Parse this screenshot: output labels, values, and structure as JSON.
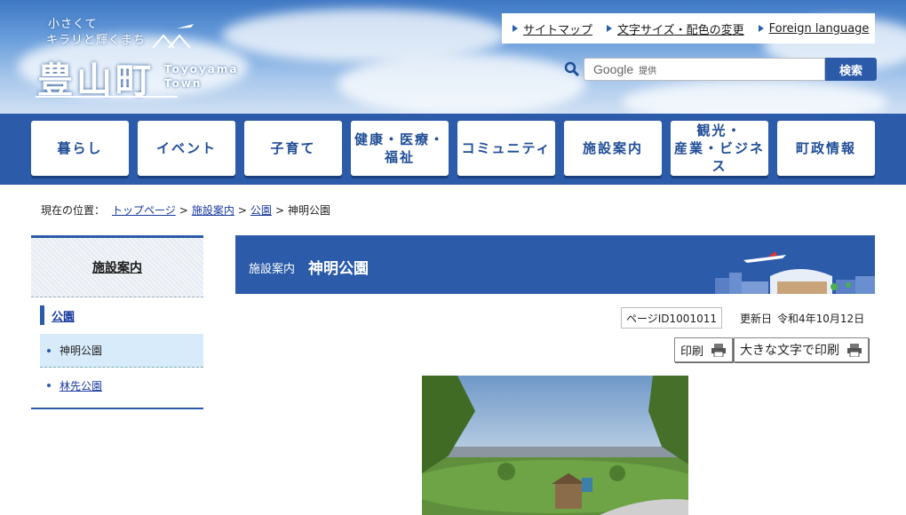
{
  "header": {
    "tagline_1": "小さくて",
    "tagline_2": "キラリと輝くまち",
    "town_name": "豊山町",
    "town_romaji_1": "Toyoyama",
    "town_romaji_2": "Town",
    "utility_links": [
      {
        "label": "サイトマップ"
      },
      {
        "label": "文字サイズ・配色の変更"
      },
      {
        "label": "Foreign language"
      }
    ],
    "search": {
      "provider": "Google",
      "provided_label": "提供",
      "button_label": "検索"
    }
  },
  "nav": {
    "items": [
      {
        "label": "暮らし"
      },
      {
        "label": "イベント"
      },
      {
        "label": "子育て"
      },
      {
        "label_1": "健康・医療・",
        "label_2": "福祉"
      },
      {
        "label": "コミュニティ"
      },
      {
        "label": "施設案内"
      },
      {
        "label_1": "観光・",
        "label_2": "産業・ビジネス"
      },
      {
        "label": "町政情報"
      }
    ]
  },
  "breadcrumb": {
    "prefix": "現在の位置：",
    "links": [
      "トップページ",
      "施設案内",
      "公園"
    ],
    "separator": ">",
    "current": "神明公園"
  },
  "sidebar": {
    "heading": "施設案内",
    "subheading": "公園",
    "items": [
      {
        "label": "神明公園",
        "active": true
      },
      {
        "label": "林先公園",
        "active": false
      }
    ]
  },
  "main": {
    "category": "施設案内",
    "title": "神明公園",
    "page_id": "ページID1001011",
    "updated_label": "更新日",
    "updated_date": "令和4年10月12日",
    "print_label": "印刷",
    "print_large_label": "大きな文字で印刷"
  },
  "colors": {
    "brand_blue": "#2b5ba9",
    "link_blue": "#1a3a9e",
    "active_bg": "#d7ebfa"
  }
}
